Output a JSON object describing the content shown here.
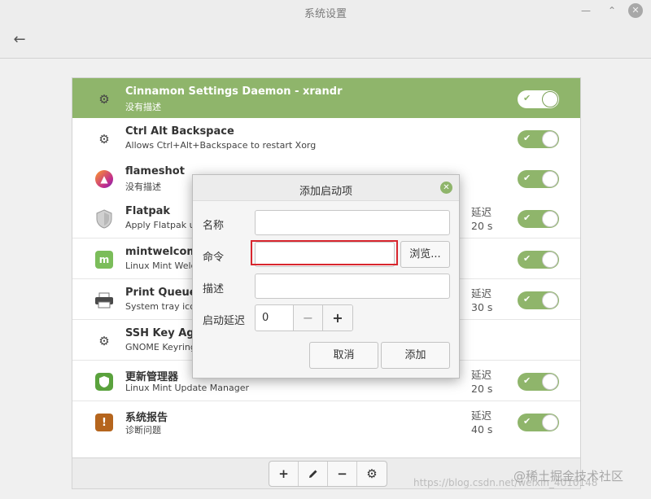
{
  "window": {
    "title": "系统设置"
  },
  "startup_list": {
    "items": [
      {
        "name": "Cinnamon Settings Daemon - xrandr",
        "desc": "没有描述",
        "delay_label": "",
        "delay_value": "",
        "enabled": true,
        "icon": "gear-icon",
        "selected": true
      },
      {
        "name": "Ctrl Alt Backspace",
        "desc": "Allows Ctrl+Alt+Backspace to restart Xorg",
        "delay_label": "",
        "delay_value": "",
        "enabled": true,
        "icon": "gear-icon"
      },
      {
        "name": "flameshot",
        "desc": "没有描述",
        "delay_label": "",
        "delay_value": "",
        "enabled": true,
        "icon": "flameshot-icon"
      },
      {
        "name": "Flatpak",
        "desc": "Apply Flatpak up",
        "delay_label": "延迟",
        "delay_value": "20 s",
        "enabled": true,
        "icon": "shield-icon"
      },
      {
        "name": "mintwelcome",
        "desc": "Linux Mint Welc",
        "delay_label": "",
        "delay_value": "",
        "enabled": true,
        "icon": "mint-icon"
      },
      {
        "name": "Print Queue",
        "desc": "System tray icor",
        "delay_label": "延迟",
        "delay_value": "30 s",
        "enabled": true,
        "icon": "printer-icon"
      },
      {
        "name": "SSH Key Age",
        "desc": "GNOME Keyring",
        "delay_label": "",
        "delay_value": "",
        "enabled": true,
        "icon": "gear-icon"
      },
      {
        "name": "更新管理器",
        "desc": "Linux Mint Update Manager",
        "delay_label": "延迟",
        "delay_value": "20 s",
        "enabled": true,
        "icon": "update-shield-icon"
      },
      {
        "name": "系统报告",
        "desc": "诊断问题",
        "delay_label": "延迟",
        "delay_value": "40 s",
        "enabled": true,
        "icon": "report-icon"
      }
    ]
  },
  "toolbar": {
    "add": "+",
    "edit_icon": "pencil-icon",
    "remove": "−",
    "settings_icon": "gear-icon"
  },
  "dialog": {
    "title": "添加启动项",
    "name_label": "名称",
    "name_value": "",
    "command_label": "命令",
    "command_value": "",
    "browse_label": "浏览...",
    "description_label": "描述",
    "description_value": "",
    "delay_label": "启动延迟",
    "delay_value": "0",
    "minus": "−",
    "plus": "+",
    "cancel_label": "取消",
    "add_label": "添加"
  },
  "watermark": {
    "site": "@稀土掘金技术社区",
    "url": "https://blog.csdn.net/weixin_4010148"
  },
  "colors": {
    "accent": "#8fb56b",
    "highlight": "#d8262e"
  }
}
